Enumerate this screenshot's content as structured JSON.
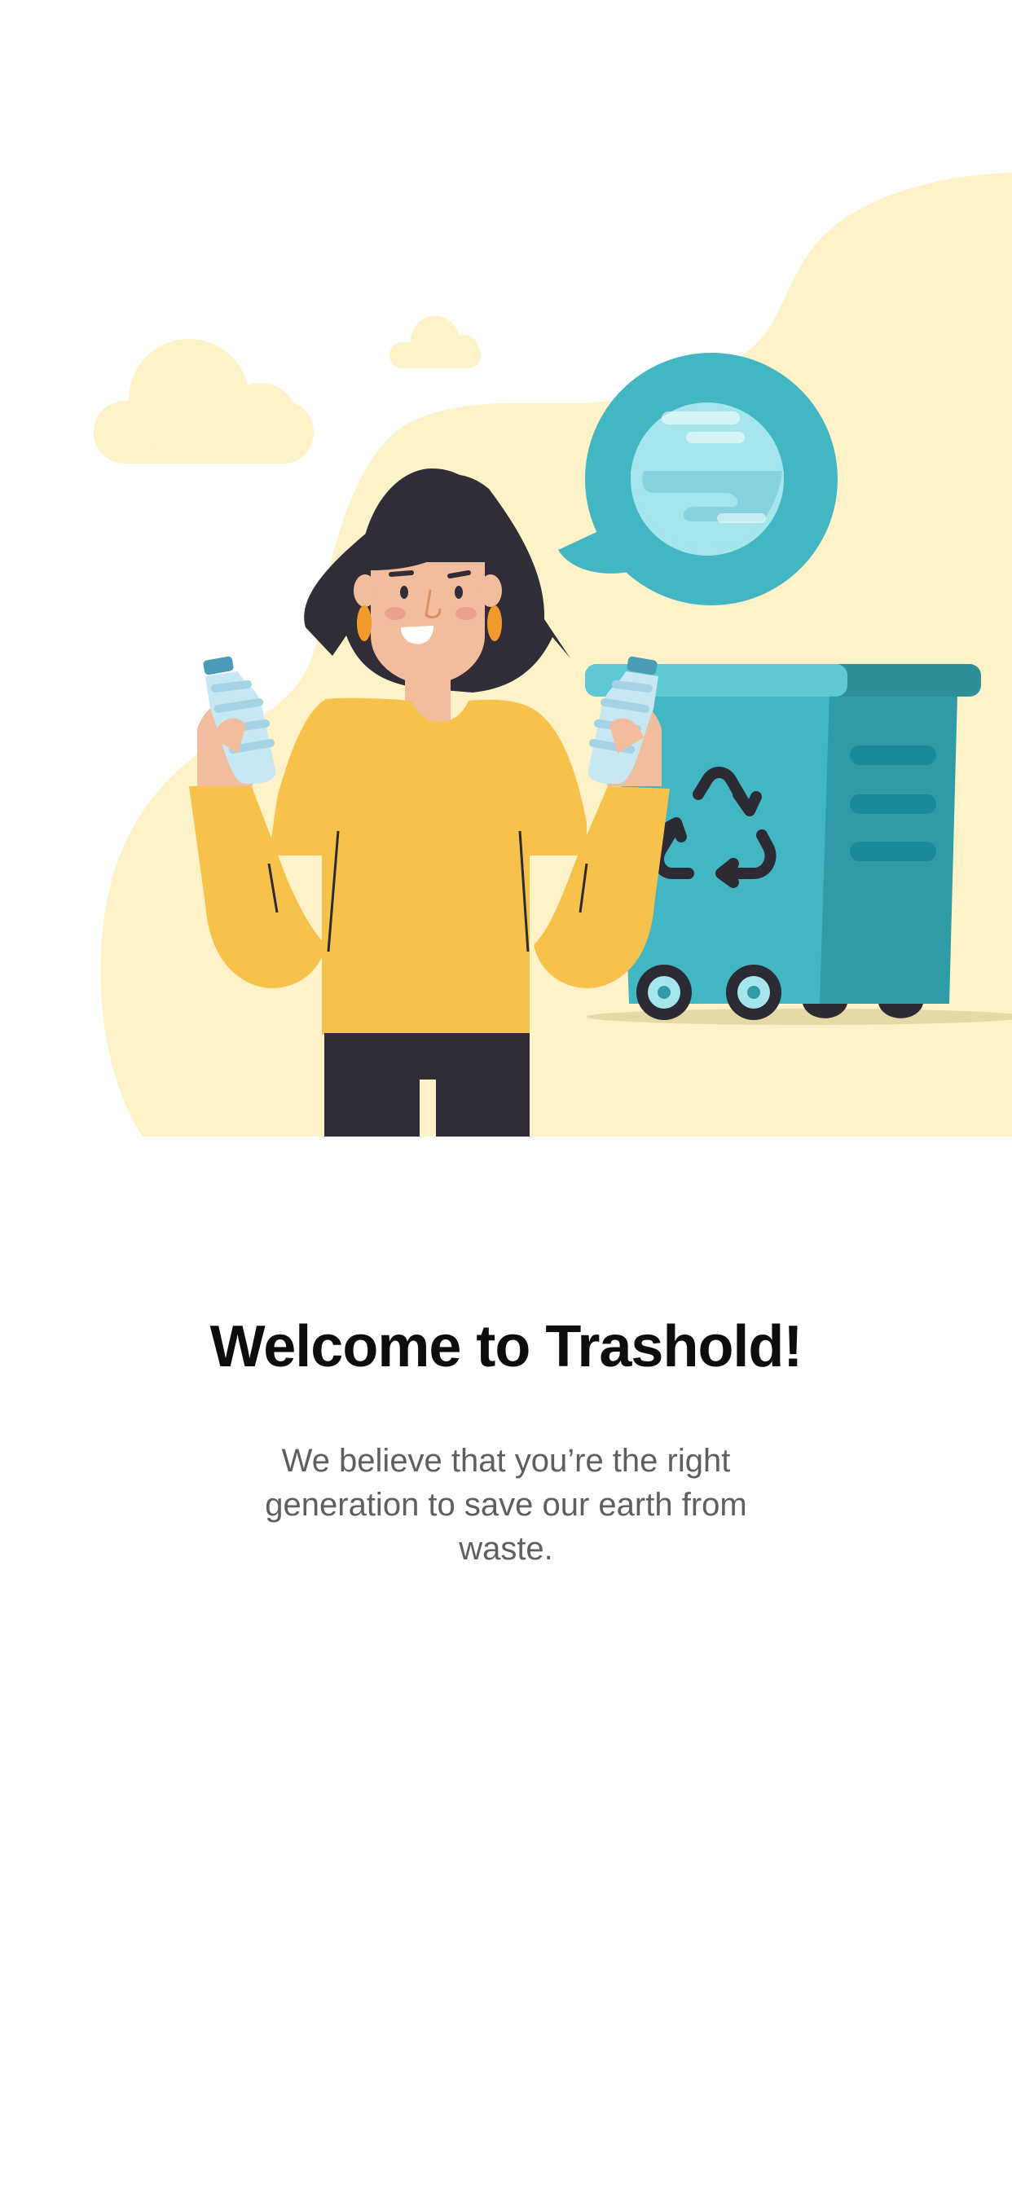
{
  "onboarding": {
    "title": "Welcome to Trashold!",
    "subtitle": "We believe that you’re the right generation to save our earth from waste."
  },
  "illustration": {
    "icons": [
      "cloud-icon",
      "globe-icon",
      "recycle-icon",
      "bottle-icon",
      "trash-bin-icon"
    ],
    "colors": {
      "background_blob": "#fdf2c8",
      "sweater": "#f7c24c",
      "hair": "#302c38",
      "skin": "#f2bd9c",
      "bin_front": "#43b6c3",
      "bin_side": "#2f9ba6",
      "globe_water": "#a5e5ec"
    }
  }
}
